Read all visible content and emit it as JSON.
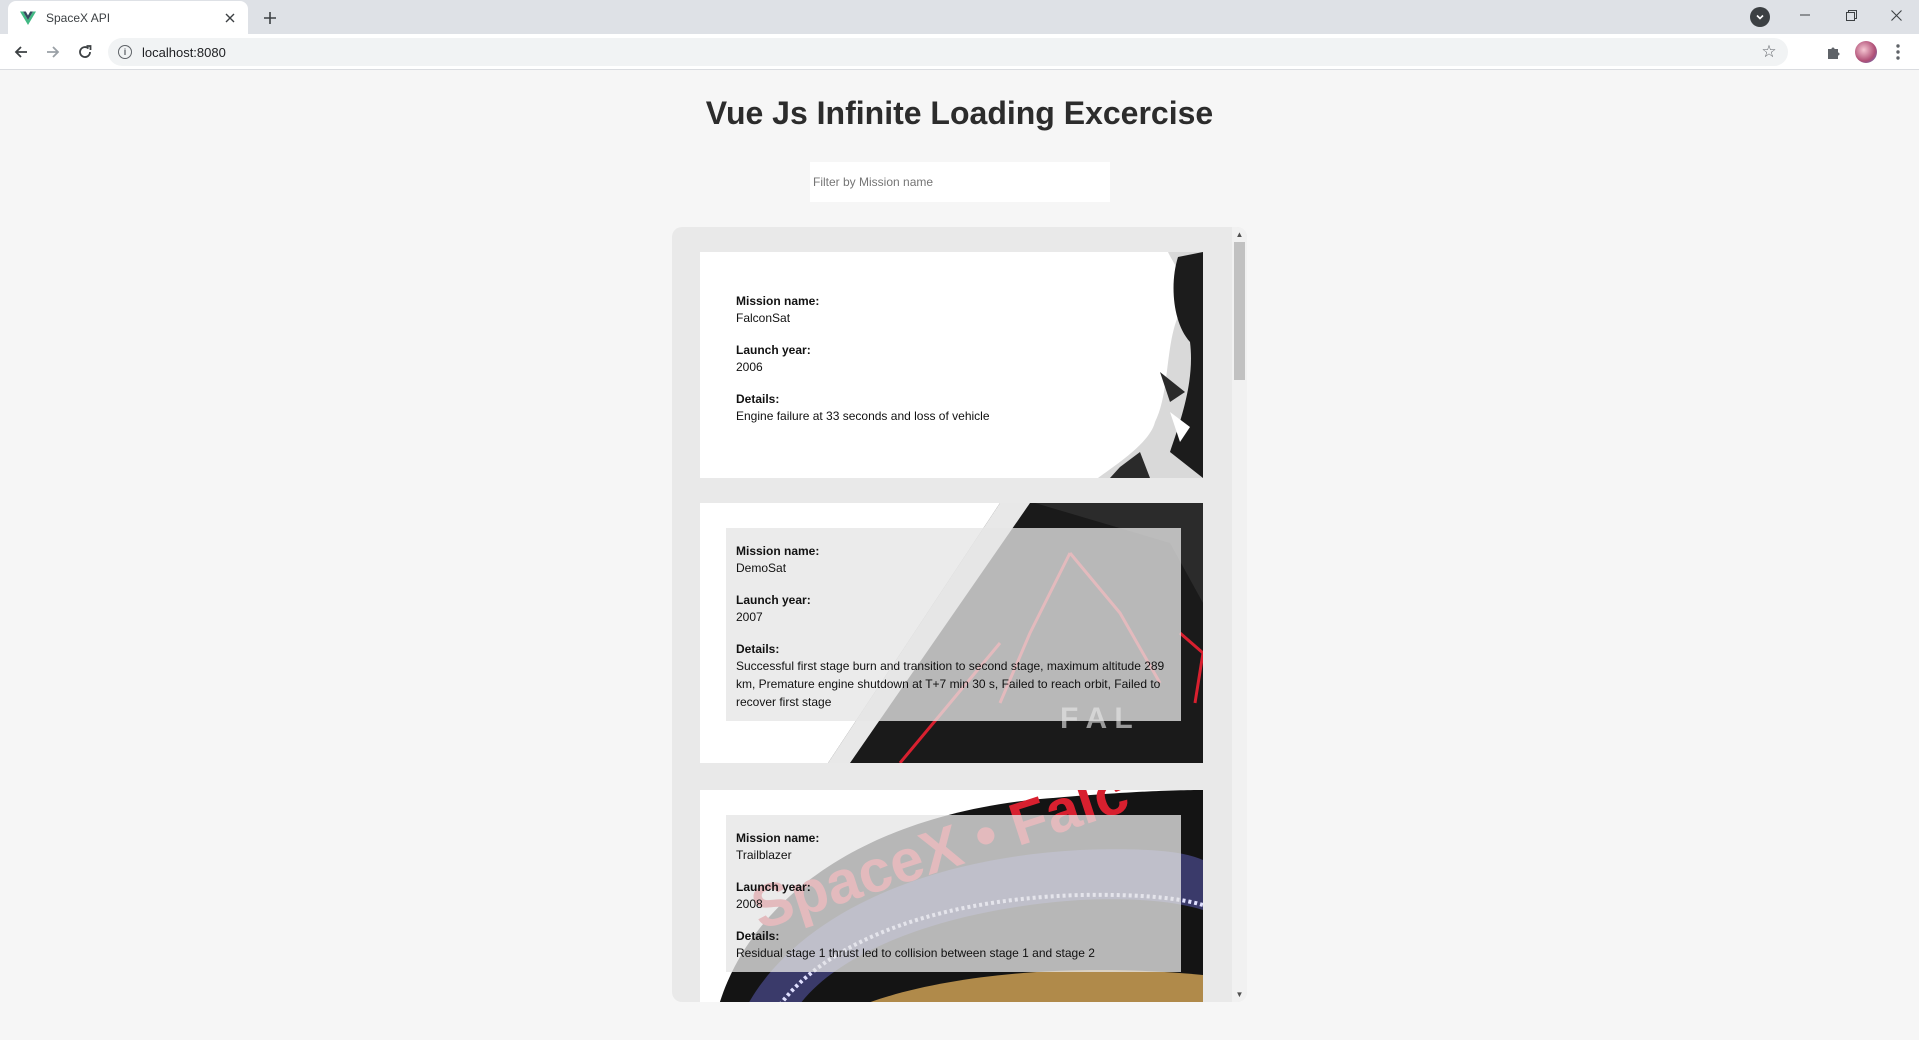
{
  "browser": {
    "tab_title": "SpaceX API",
    "url": "localhost:8080"
  },
  "page": {
    "title": "Vue Js Infinite Loading Excercise",
    "filter_placeholder": "Filter by Mission name"
  },
  "labels": {
    "mission_name": "Mission name:",
    "launch_year": "Launch year:",
    "details": "Details:"
  },
  "launches": [
    {
      "mission_name": "FalconSat",
      "launch_year": "2006",
      "details": "Engine failure at 33 seconds and loss of vehicle"
    },
    {
      "mission_name": "DemoSat",
      "launch_year": "2007",
      "details": "Successful first stage burn and transition to second stage, maximum altitude 289 km, Premature engine shutdown at T+7 min 30 s, Failed to reach orbit, Failed to recover first stage"
    },
    {
      "mission_name": "Trailblazer",
      "launch_year": "2008",
      "details": "Residual stage 1 thrust led to collision between stage 1 and stage 2"
    }
  ],
  "patch_text": "SpaceX • Falc",
  "colors": {
    "page_bg": "#f6f6f6",
    "panel_bg": "#e9e9e9",
    "card_bg": "#ffffff",
    "accent_red": "#d8202f",
    "vue_green": "#41b883"
  }
}
